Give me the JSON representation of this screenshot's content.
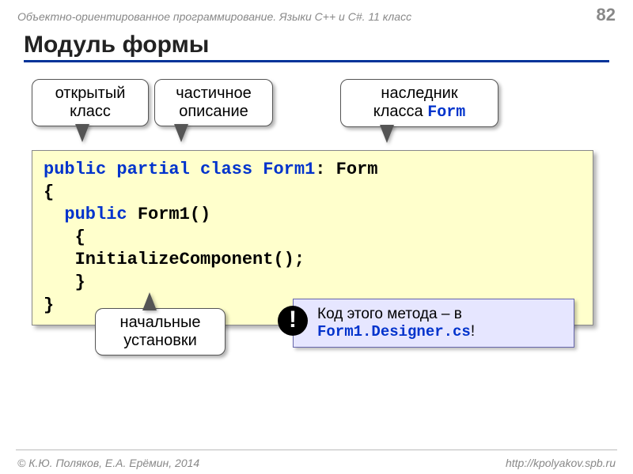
{
  "header": {
    "course": "Объектно-ориентированное программирование. Языки C++ и C#. 11 класс",
    "page": "82"
  },
  "title": "Модуль формы",
  "callouts": {
    "c1": {
      "line1": "открытый",
      "line2": "класс"
    },
    "c2": {
      "line1": "частичное",
      "line2": "описание"
    },
    "c3": {
      "line1": "наследник",
      "line2_a": "класса ",
      "line2_b": "Form"
    },
    "c4": {
      "line1": "начальные",
      "line2": "установки"
    }
  },
  "code": {
    "l1a": "public",
    "l1b": " ",
    "l1c": "partial",
    "l1d": " ",
    "l1e": "class",
    "l1f": " ",
    "l1g": "Form1",
    "l1h": ": Form",
    "l2": "{",
    "l3a": "  ",
    "l3b": "public",
    "l3c": " Form1()",
    "l4": "   {",
    "l5": "   InitializeComponent();",
    "l6": "   }",
    "l7": "}"
  },
  "note": {
    "bang": "!",
    "text1": "Код этого метода – в",
    "file": "Form1.Designer.cs",
    "excl": "!"
  },
  "footer": {
    "left": "© К.Ю. Поляков, Е.А. Ерёмин, 2014",
    "right": "http://kpolyakov.spb.ru"
  }
}
